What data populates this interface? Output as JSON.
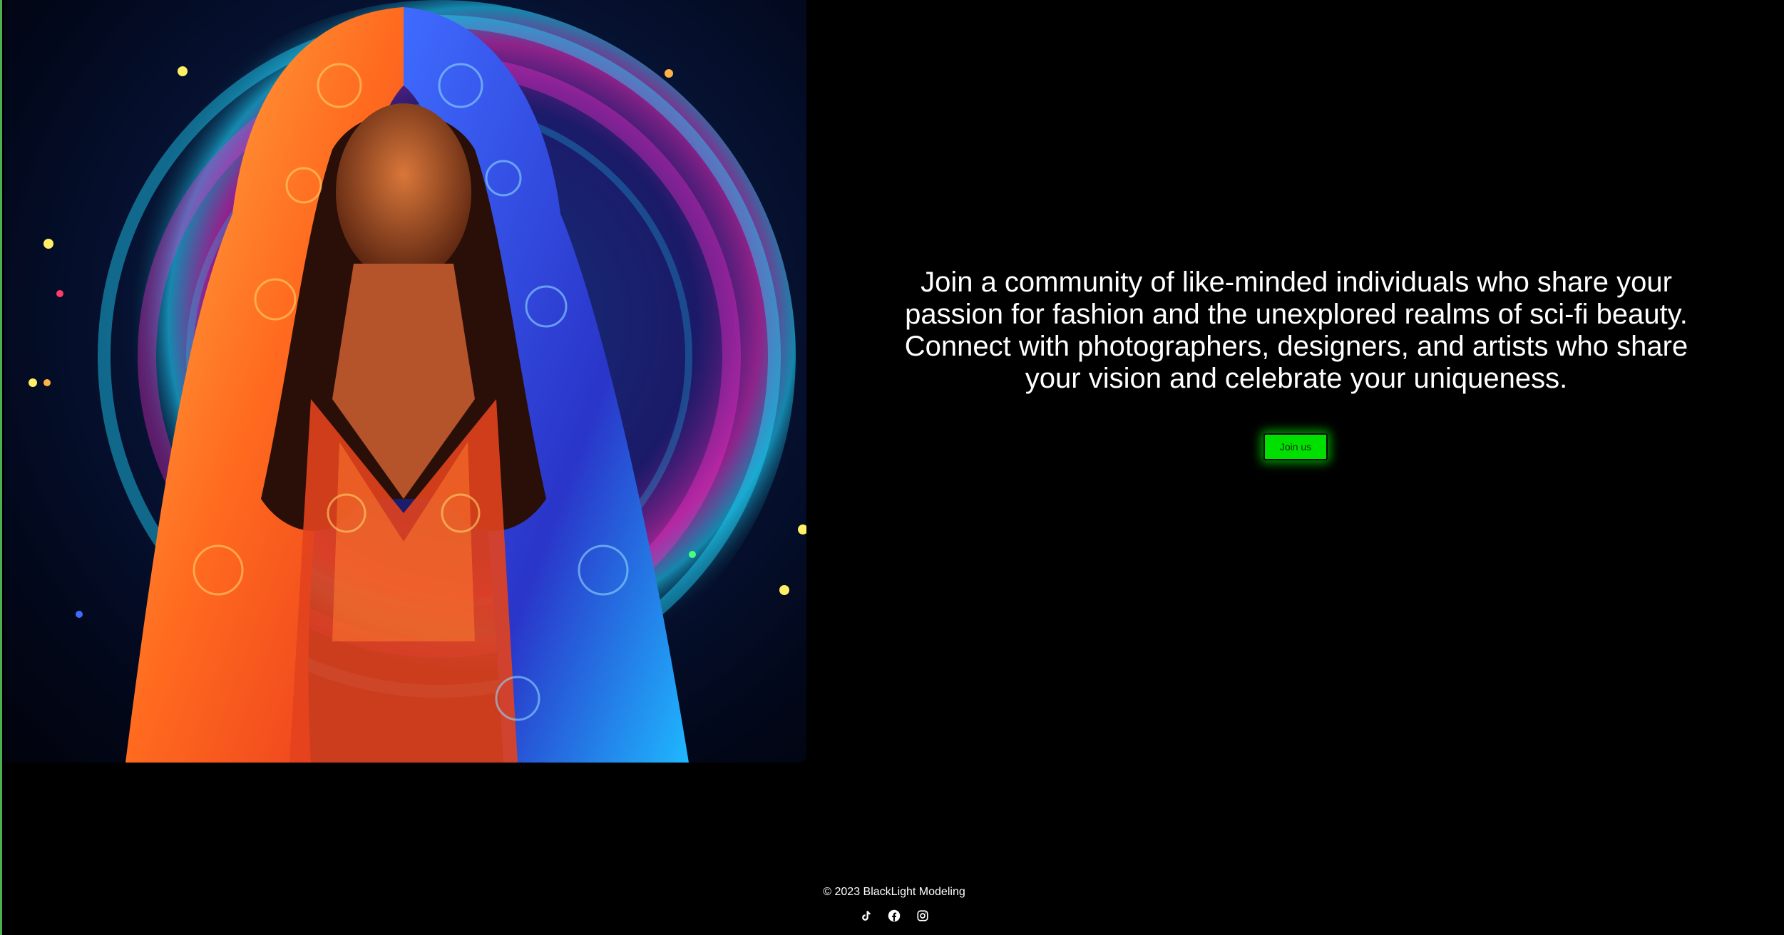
{
  "hero": {
    "image_subject": "hooded woman in neon patterned robe against glowing circular background",
    "colors": {
      "robe_warm": "#ff6a1f",
      "robe_cool": "#2f5bff",
      "glow_pink": "#ff2fd0",
      "glow_cyan": "#1fd6ff"
    }
  },
  "intro": {
    "text": "Join a community of like-minded individuals who share your passion for fashion and the unexplored realms of sci-fi beauty. Connect with photographers, designers, and artists who share your vision and celebrate your uniqueness."
  },
  "cta": {
    "label": "Join us",
    "color": "#00e000"
  },
  "footer": {
    "copyright": "© 2023 BlackLight Modeling",
    "social": [
      {
        "name": "tiktok-icon"
      },
      {
        "name": "facebook-icon"
      },
      {
        "name": "instagram-icon"
      }
    ]
  }
}
